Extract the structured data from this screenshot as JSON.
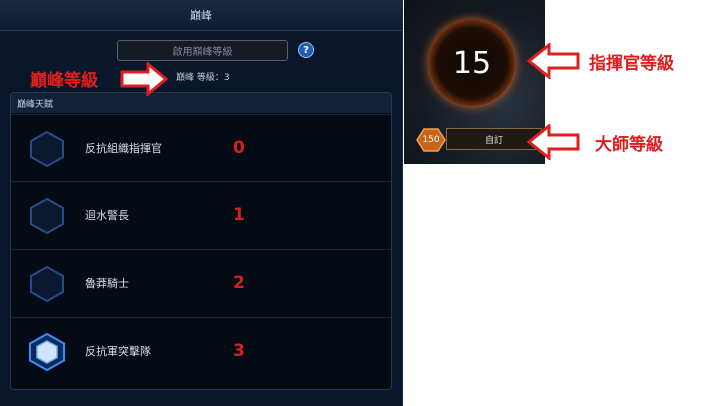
{
  "panel": {
    "title": "巔峰",
    "enable_button": "啟用巔峰等級",
    "help_icon": "?",
    "level_text": "巔峰 等級：3",
    "talent_section_title": "巔峰天賦"
  },
  "talents": [
    {
      "label": "反抗組織指揮官",
      "number": "0",
      "active": false
    },
    {
      "label": "迴水警長",
      "number": "1",
      "active": false
    },
    {
      "label": "魯莽騎士",
      "number": "2",
      "active": false
    },
    {
      "label": "反抗軍突擊隊",
      "number": "3",
      "active": true
    }
  ],
  "portrait": {
    "commander_level": "15",
    "master_level": "150",
    "custom_label": "自訂"
  },
  "annotations": {
    "paragon_level": "巔峰等級",
    "commander_level": "指揮官等級",
    "master_level": "大師等級"
  },
  "colors": {
    "annotation": "#e01e1e",
    "accent_orange": "#f07a28",
    "active_hex": "#3b8cff"
  }
}
